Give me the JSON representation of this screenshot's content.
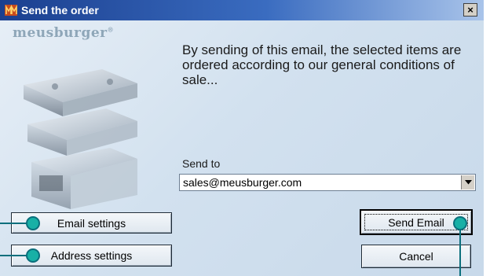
{
  "window": {
    "title": "Send the order",
    "close_label": "×"
  },
  "brand": {
    "logo_text": "meusburger",
    "logo_mark": "®"
  },
  "main": {
    "description": "By sending of this email, the selected items are ordered according to our general conditions of sale...",
    "send_to_label": "Send to",
    "email_value": "sales@meusburger.com"
  },
  "buttons": {
    "email_settings": "Email settings",
    "address_settings": "Address settings",
    "send_email": "Send Email",
    "cancel": "Cancel"
  },
  "icons": {
    "app": "meusburger-app-icon",
    "close": "close-icon",
    "dropdown": "chevron-down-icon",
    "illustration": "mold-base-illustration",
    "callout": "callout-marker"
  },
  "colors": {
    "titlebar": "#1b3f8f",
    "dialog_bg": "#d8e6f2",
    "callout": "#18b0a6",
    "callout_line": "#0b6f7c"
  }
}
